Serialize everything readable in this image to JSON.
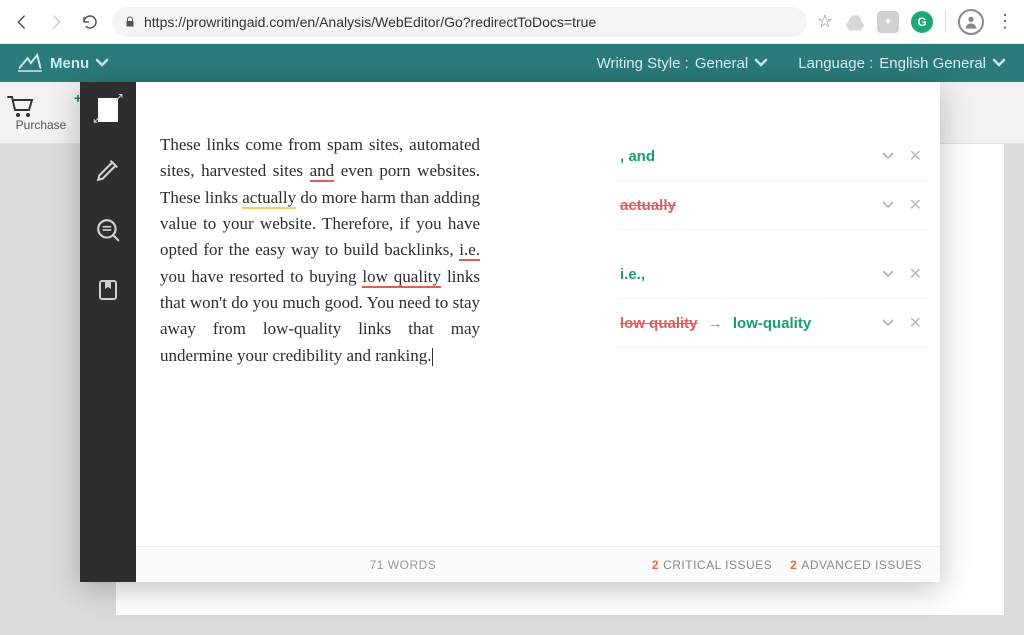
{
  "browser": {
    "url": "https://prowritingaid.com/en/Analysis/WebEditor/Go?redirectToDocs=true",
    "extensions": {
      "g_badge": "G"
    }
  },
  "app_header": {
    "menu_label": "Menu",
    "style_label": "Writing Style :",
    "style_value": "General",
    "language_label": "Language :",
    "language_value": "English General"
  },
  "toolbar": {
    "purchase_label": "Purchase"
  },
  "editor": {
    "essay": {
      "p1a": "These links come from spam sites, automated sites, harvested sites ",
      "and": "and",
      "p1b": " even porn websites. These links ",
      "actually": "actually",
      "p1c": " do more harm than adding value to your website. Therefore, if you have opted for the easy way to build backlinks, ",
      "ie": "i.e.",
      "p1d": " you have resorted to buying ",
      "lowquality": "low quality",
      "p1e": " links that won't do you much good. You need to stay away from low-quality links that may undermine your credibility and ranking."
    },
    "word_count_label": "71 WORDS"
  },
  "suggestions": [
    {
      "type": "green",
      "text": ", and"
    },
    {
      "type": "red-strike",
      "text": "actually"
    },
    {
      "type": "green",
      "text": "i.e.,"
    },
    {
      "type": "correction",
      "wrong": "low quality",
      "right": "low-quality",
      "arrow": "→"
    }
  ],
  "footer": {
    "critical_count": "2",
    "critical_label": "CRITICAL ISSUES",
    "advanced_count": "2",
    "advanced_label": "ADVANCED ISSUES"
  }
}
